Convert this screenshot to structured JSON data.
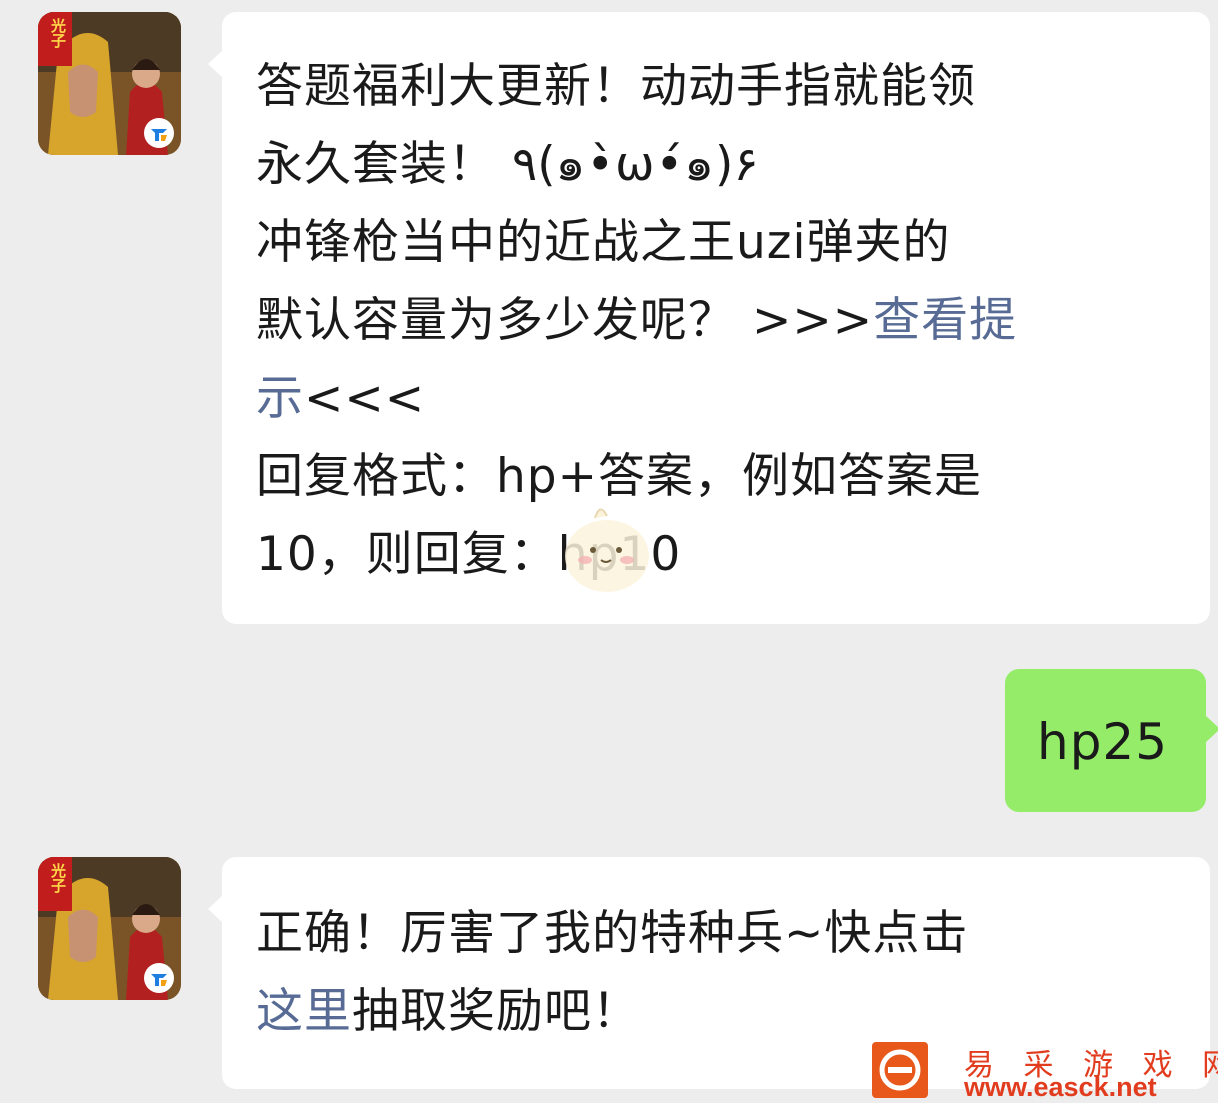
{
  "messages": [
    {
      "sender": "official-account",
      "lines": [
        [
          {
            "text": "答题福利大更新！动动手指就能领"
          }
        ],
        [
          {
            "text": "永久套装！ ٩(๑•̀ω•́๑)۶"
          }
        ],
        [
          {
            "text": "冲锋枪当中的近战之王uzi弹夹的"
          }
        ],
        [
          {
            "text": "默认容量为多少发呢？ >>>"
          },
          {
            "text": "查看提",
            "link": true
          }
        ],
        [
          {
            "text": "示",
            "link": true
          },
          {
            "text": "<<<"
          }
        ],
        [
          {
            "text": "回复格式：hp+答案，例如答案是"
          }
        ],
        [
          {
            "text": "10，则回复：hp10"
          }
        ]
      ]
    },
    {
      "sender": "me",
      "text": "hp25"
    },
    {
      "sender": "official-account",
      "lines": [
        [
          {
            "text": "正确！厉害了我的特种兵~快点击"
          }
        ],
        [
          {
            "text": "这里",
            "link": true
          },
          {
            "text": "抽取奖励吧！"
          }
        ]
      ]
    }
  ],
  "avatar": {
    "badge": "光子",
    "icon": "tencent-games-icon"
  },
  "watermark": {
    "site_name": "易 采 游 戏 网",
    "url": "www.easck.net"
  },
  "colors": {
    "background": "#ededed",
    "incoming_bubble": "#ffffff",
    "outgoing_bubble": "#95ec69",
    "link": "#576b95",
    "watermark": "#e23c1f"
  }
}
